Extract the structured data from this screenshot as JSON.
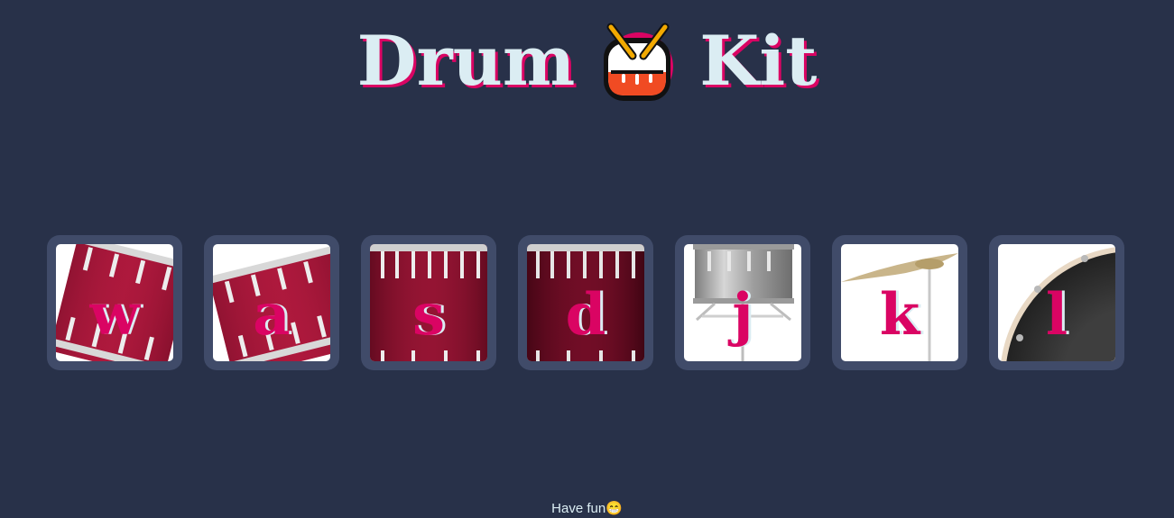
{
  "header": {
    "title_left": "Drum",
    "logo_icon": "drum-emoji",
    "title_right": "Kit"
  },
  "drums": [
    {
      "key": "w",
      "icon": "tom-drum-tilted"
    },
    {
      "key": "a",
      "icon": "tom-drum-tilted"
    },
    {
      "key": "s",
      "icon": "snare-drum"
    },
    {
      "key": "d",
      "icon": "snare-drum-dark"
    },
    {
      "key": "j",
      "icon": "silver-drum-stand"
    },
    {
      "key": "k",
      "icon": "crash-cymbal"
    },
    {
      "key": "l",
      "icon": "bass-drum"
    }
  ],
  "footer": {
    "text": "Have fun😁"
  },
  "colors": {
    "background": "#283149",
    "pad_frame": "#404B69",
    "accent": "#DA0463",
    "text_light": "#DBEDF3"
  }
}
